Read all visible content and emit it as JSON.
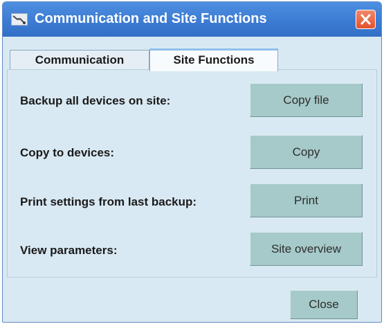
{
  "window": {
    "title": "Communication and Site Functions",
    "title_icon": "connector-plug-icon",
    "close_icon": "close-x-icon"
  },
  "tabs": [
    {
      "label": "Communication",
      "selected": false
    },
    {
      "label": "Site Functions",
      "selected": true
    }
  ],
  "rows": [
    {
      "label": "Backup all devices on site:",
      "button": "Copy file"
    },
    {
      "label": "Copy to devices:",
      "button": "Copy"
    },
    {
      "label": "Print settings from last backup:",
      "button": "Print"
    },
    {
      "label": "View parameters:",
      "button": "Site overview"
    }
  ],
  "footer": {
    "close_label": "Close"
  },
  "colors": {
    "titlebar": "#3f7fd6",
    "close_button": "#e2512b",
    "button_face": "#a6c9c9",
    "panel_bg": "#d9e9f3"
  }
}
